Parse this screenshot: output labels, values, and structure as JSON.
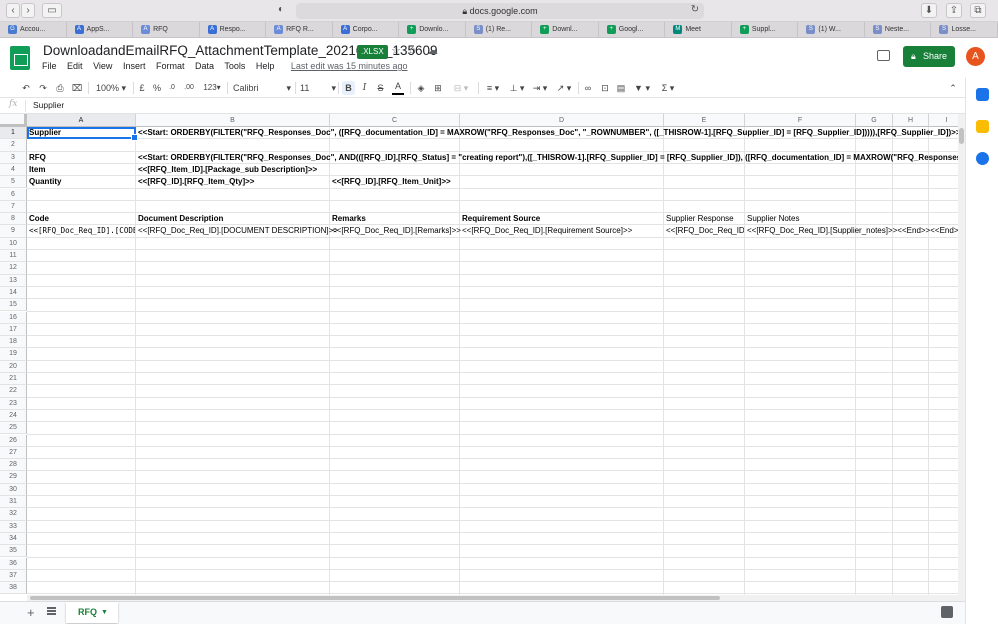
{
  "browser": {
    "url": "docs.google.com",
    "tabs": [
      {
        "label": "Accou...",
        "color": "#4a7bd0",
        "letter": "G"
      },
      {
        "label": "AppS...",
        "color": "#3b6fd6",
        "letter": "A"
      },
      {
        "label": "RFQ",
        "color": "#6b8cd8",
        "letter": "A"
      },
      {
        "label": "Respo...",
        "color": "#3b6fd6",
        "letter": "A"
      },
      {
        "label": "RFQ R...",
        "color": "#6b8cd8",
        "letter": "A"
      },
      {
        "label": "Corpo...",
        "color": "#3b6fd6",
        "letter": "A"
      },
      {
        "label": "Downlo...",
        "color": "#0f9d58",
        "letter": "+"
      },
      {
        "label": "(1) Re...",
        "color": "#7a8fc8",
        "letter": "S"
      },
      {
        "label": "Downl...",
        "color": "#0f9d58",
        "letter": "+"
      },
      {
        "label": "Googl...",
        "color": "#0f9d58",
        "letter": "+"
      },
      {
        "label": "Meet",
        "color": "#00897b",
        "letter": "M"
      },
      {
        "label": "Suppl...",
        "color": "#0f9d58",
        "letter": "+"
      },
      {
        "label": "(1) W...",
        "color": "#7a8fc8",
        "letter": "S"
      },
      {
        "label": "Neste...",
        "color": "#7a8fc8",
        "letter": "S"
      },
      {
        "label": "Losse...",
        "color": "#7a8fc8",
        "letter": "S"
      }
    ]
  },
  "doc": {
    "title": "DownloadandEmailRFQ_AttachmentTemplate_20210119_135609",
    "badge": ".XLSX",
    "menu": [
      "File",
      "Edit",
      "View",
      "Insert",
      "Format",
      "Data",
      "Tools",
      "Help"
    ],
    "last_edit": "Last edit was 15 minutes ago",
    "share_label": "Share",
    "avatar_letter": "A"
  },
  "toolbar": {
    "zoom": "100%",
    "currency": "£",
    "percent": "%",
    "dec_less": ".0",
    "dec_more": ".00",
    "format_more": "123",
    "font": "Calibri",
    "font_size": "11",
    "bold": "B",
    "italic": "I",
    "strike": "S",
    "text_color": "A"
  },
  "formula_bar": {
    "fx": "fx",
    "value": "Supplier"
  },
  "grid": {
    "columns": [
      "A",
      "B",
      "C",
      "D",
      "E",
      "F",
      "G",
      "H",
      "I"
    ],
    "row_count": 38,
    "selected_column": "A",
    "selected_row": 1,
    "cells": {
      "A1": "Supplier",
      "B1": "<<Start: ORDERBY(FILTER(\"RFQ_Responses_Doc\", ([RFQ_documentation_ID] = MAXROW(\"RFQ_Responses_Doc\", \"_ROWNUMBER\", ([_THISROW-1].[RFQ_Supplier_ID] = [RFQ_Supplier_ID])))),[RFQ_Supplier_ID])>>",
      "A3": "RFQ",
      "B3": "<<Start: ORDERBY(FILTER(\"RFQ_Responses_Doc\", AND(([RFQ_ID].[RFQ_Status] = \"creating report\"),([_THISROW-1].[RFQ_Supplier_ID] = [RFQ_Supplier_ID]), ([RFQ_documentation_ID] = MAXROW(\"RFQ_Responses_Doc\", \"_",
      "A4": "Item",
      "B4": "<<[RFQ_Item_ID].[Package_sub Description]>>",
      "A5": "Quantity",
      "B5": "<<[RFQ_ID].[RFQ_Item_Qty]>>",
      "C5": "<<[RFQ_ID].[RFQ_Item_Unit]>>",
      "A8": "Code",
      "B8": "Document Description",
      "C8": "Remarks",
      "D8": "Requirement Source",
      "E8": "Supplier Response",
      "F8": "Supplier Notes",
      "A9": "<<[RFQ_Doc_Req_ID].[CODE]>>",
      "B9": "<<[RFQ_Doc_Req_ID].[DOCUMENT DESCRIPTION]>>",
      "C9": "<<[RFQ_Doc_Req_ID].[Remarks]>>",
      "D9": "<<[RFQ_Doc_Req_ID].[Requirement Source]>>",
      "E9": "<<[RFQ_Doc_Req_ID]",
      "F9": "<<[RFQ_Doc_Req_ID].[Supplier_notes]>><<End>><<End>>"
    }
  },
  "sheets": [
    {
      "name": "RFQ",
      "active": true
    }
  ],
  "colors": {
    "sheets_green": "#188038",
    "select_blue": "#1a73e8"
  }
}
